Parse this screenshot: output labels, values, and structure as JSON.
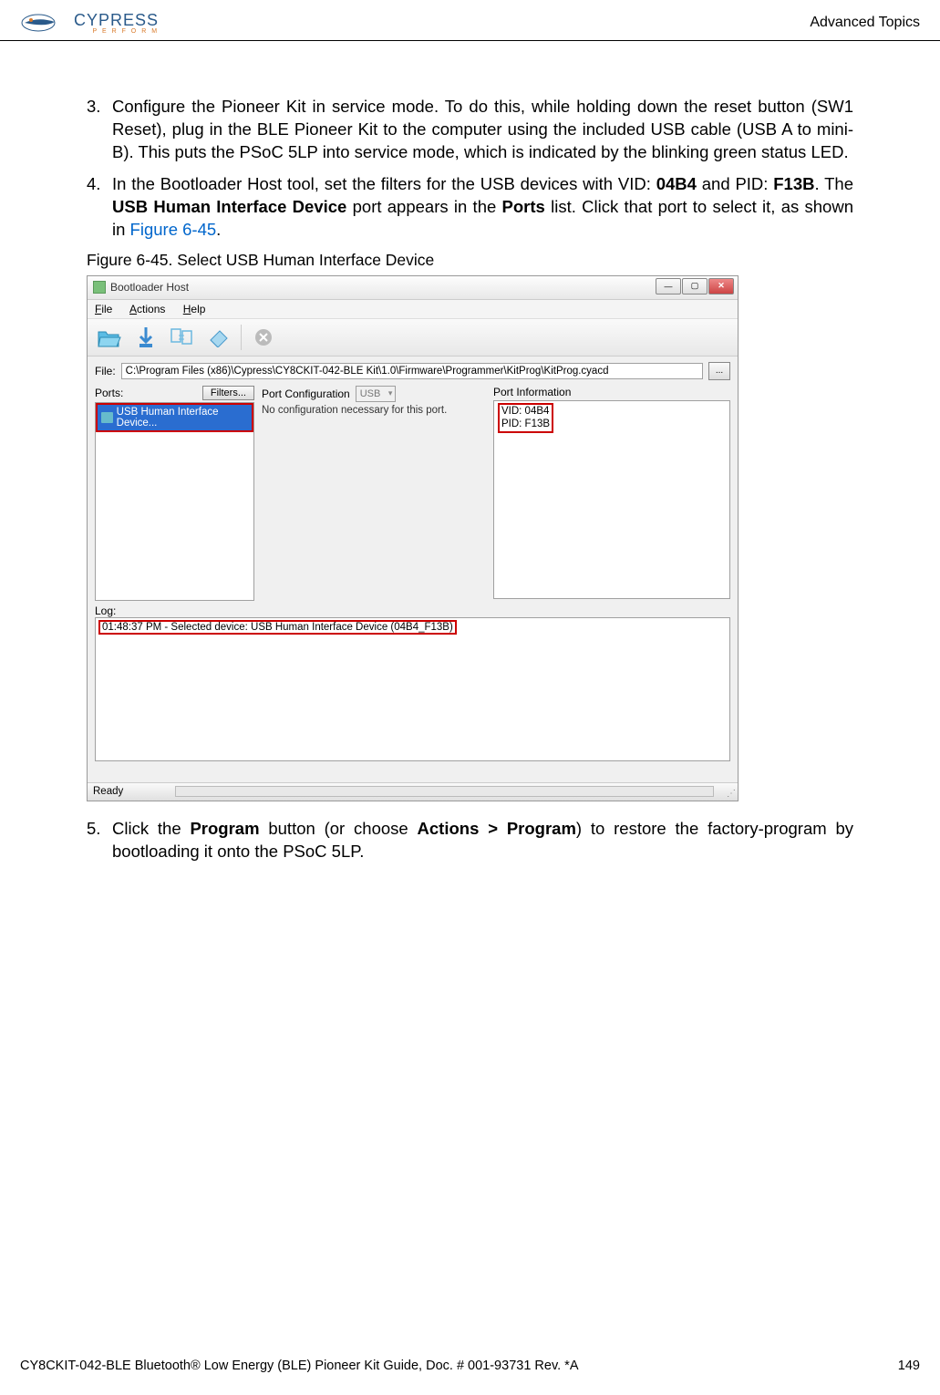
{
  "header": {
    "brand": "CYPRESS",
    "brand_sub": "P E R F O R M",
    "section_title": "Advanced Topics"
  },
  "steps": {
    "s3_num": "3.",
    "s3_text": "Configure the Pioneer Kit in service mode. To do this, while holding down the reset button (SW1 Reset), plug in the BLE Pioneer Kit to the computer using the included USB cable (USB A to mini-B). This puts the PSoC 5LP into service mode, which is indicated by the blinking green status LED.",
    "s4_num": "4.",
    "s4_pre": "In the Bootloader Host tool, set the filters for the USB devices with VID: ",
    "s4_vid": "04B4",
    "s4_mid1": " and PID: ",
    "s4_pid": "F13B",
    "s4_mid2": ". The ",
    "s4_b1": "USB Human Interface Device",
    "s4_mid3": " port appears in the ",
    "s4_b2": "Ports",
    "s4_mid4": " list. Click that port to select it, as shown in ",
    "s4_link": "Figure 6-45",
    "s4_end": ".",
    "s5_num": "5.",
    "s5_pre": "Click the ",
    "s5_b1": "Program",
    "s5_mid1": " button (or choose ",
    "s5_b2": "Actions > Program",
    "s5_end": ") to restore the factory-program by bootloading it onto the PSoC 5LP."
  },
  "figure_caption": "Figure 6-45.  Select USB Human Interface Device",
  "bootloader": {
    "title": "Bootloader Host",
    "menu_file": "File",
    "menu_actions": "Actions",
    "menu_help": "Help",
    "file_label": "File:",
    "file_path": "C:\\Program Files (x86)\\Cypress\\CY8CKIT-042-BLE Kit\\1.0\\Firmware\\Programmer\\KitProg\\KitProg.cyacd",
    "file_browse": "...",
    "ports_label": "Ports:",
    "filters_btn": "Filters...",
    "port_item": "USB Human Interface Device...",
    "config_label": "Port Configuration",
    "config_select": "USB",
    "config_text": "No configuration necessary for this port.",
    "info_label": "Port Information",
    "info_vid": "VID: 04B4",
    "info_pid": "PID: F13B",
    "log_label": "Log:",
    "log_entry": "01:48:37 PM - Selected device: USB Human Interface Device (04B4_F13B)",
    "status": "Ready"
  },
  "footer": {
    "doc_ref": "CY8CKIT-042-BLE Bluetooth® Low Energy (BLE) Pioneer Kit Guide, Doc. # 001-93731 Rev. *A",
    "page_num": "149"
  }
}
